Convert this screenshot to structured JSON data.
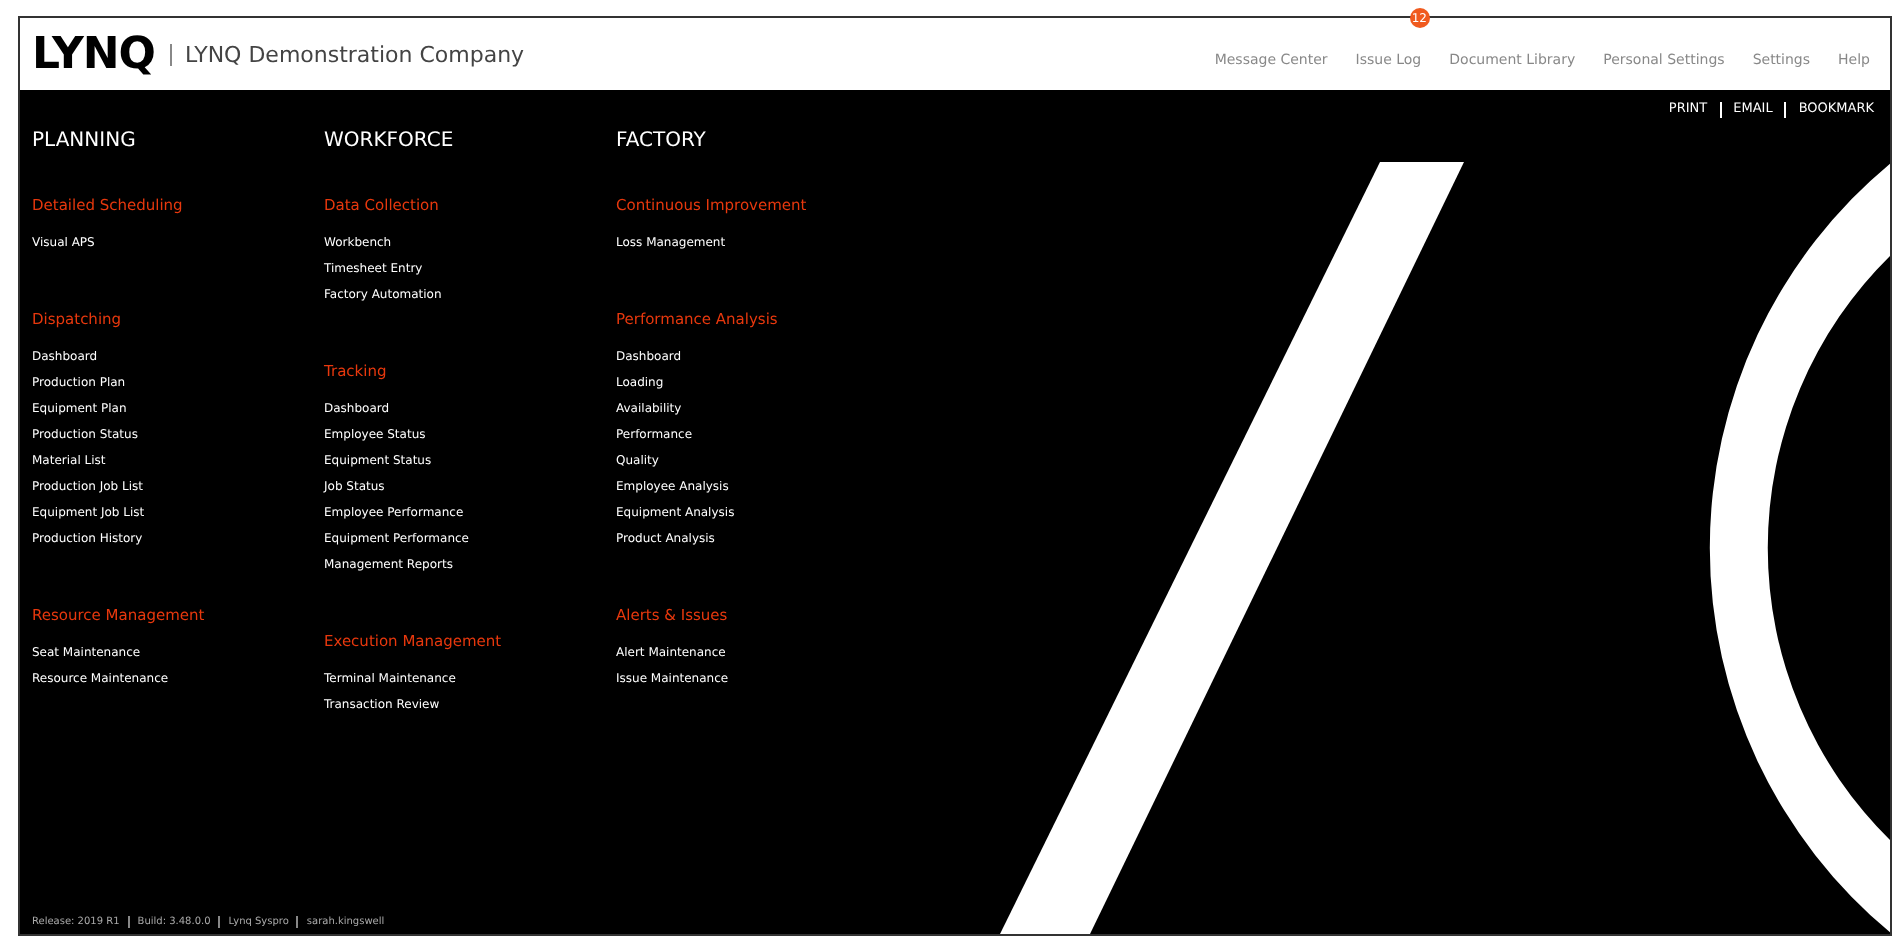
{
  "header": {
    "logo": "LYNQ",
    "company": "LYNQ Demonstration Company",
    "nav": [
      {
        "label": "Message Center"
      },
      {
        "label": "Issue Log",
        "badge": "12"
      },
      {
        "label": "Document Library"
      },
      {
        "label": "Personal Settings"
      },
      {
        "label": "Settings"
      },
      {
        "label": "Help"
      }
    ]
  },
  "actions": [
    "PRINT",
    "EMAIL",
    "BOOKMARK"
  ],
  "columns": [
    {
      "title": "PLANNING",
      "sections": [
        {
          "heading": "Detailed Scheduling",
          "items": [
            "Visual APS"
          ]
        },
        {
          "heading": "Dispatching",
          "items": [
            "Dashboard",
            "Production Plan",
            "Equipment Plan",
            "Production Status",
            "Material List",
            "Production Job List",
            "Equipment Job List",
            "Production History"
          ]
        },
        {
          "heading": "Resource Management",
          "items": [
            "Seat Maintenance",
            "Resource Maintenance"
          ]
        }
      ]
    },
    {
      "title": "WORKFORCE",
      "sections": [
        {
          "heading": "Data Collection",
          "items": [
            "Workbench",
            "Timesheet Entry",
            "Factory Automation"
          ]
        },
        {
          "heading": "Tracking",
          "items": [
            "Dashboard",
            "Employee Status",
            "Equipment Status",
            "Job Status",
            "Employee Performance",
            "Equipment Performance",
            "Management Reports"
          ]
        },
        {
          "heading": "Execution Management",
          "items": [
            "Terminal Maintenance",
            "Transaction Review"
          ]
        }
      ]
    },
    {
      "title": "FACTORY",
      "sections": [
        {
          "heading": "Continuous Improvement",
          "items": [
            "Loss Management"
          ]
        },
        {
          "heading": "Performance Analysis",
          "items": [
            "Dashboard",
            "Loading",
            "Availability",
            "Performance",
            "Quality",
            "Employee Analysis",
            "Equipment Analysis",
            "Product Analysis"
          ]
        },
        {
          "heading": "Alerts & Issues",
          "items": [
            "Alert Maintenance",
            "Issue Maintenance"
          ]
        }
      ]
    }
  ],
  "footer": [
    "Release: 2019 R1",
    "Build: 3.48.0.0",
    "Lynq Syspro",
    "sarah.kingswell"
  ]
}
